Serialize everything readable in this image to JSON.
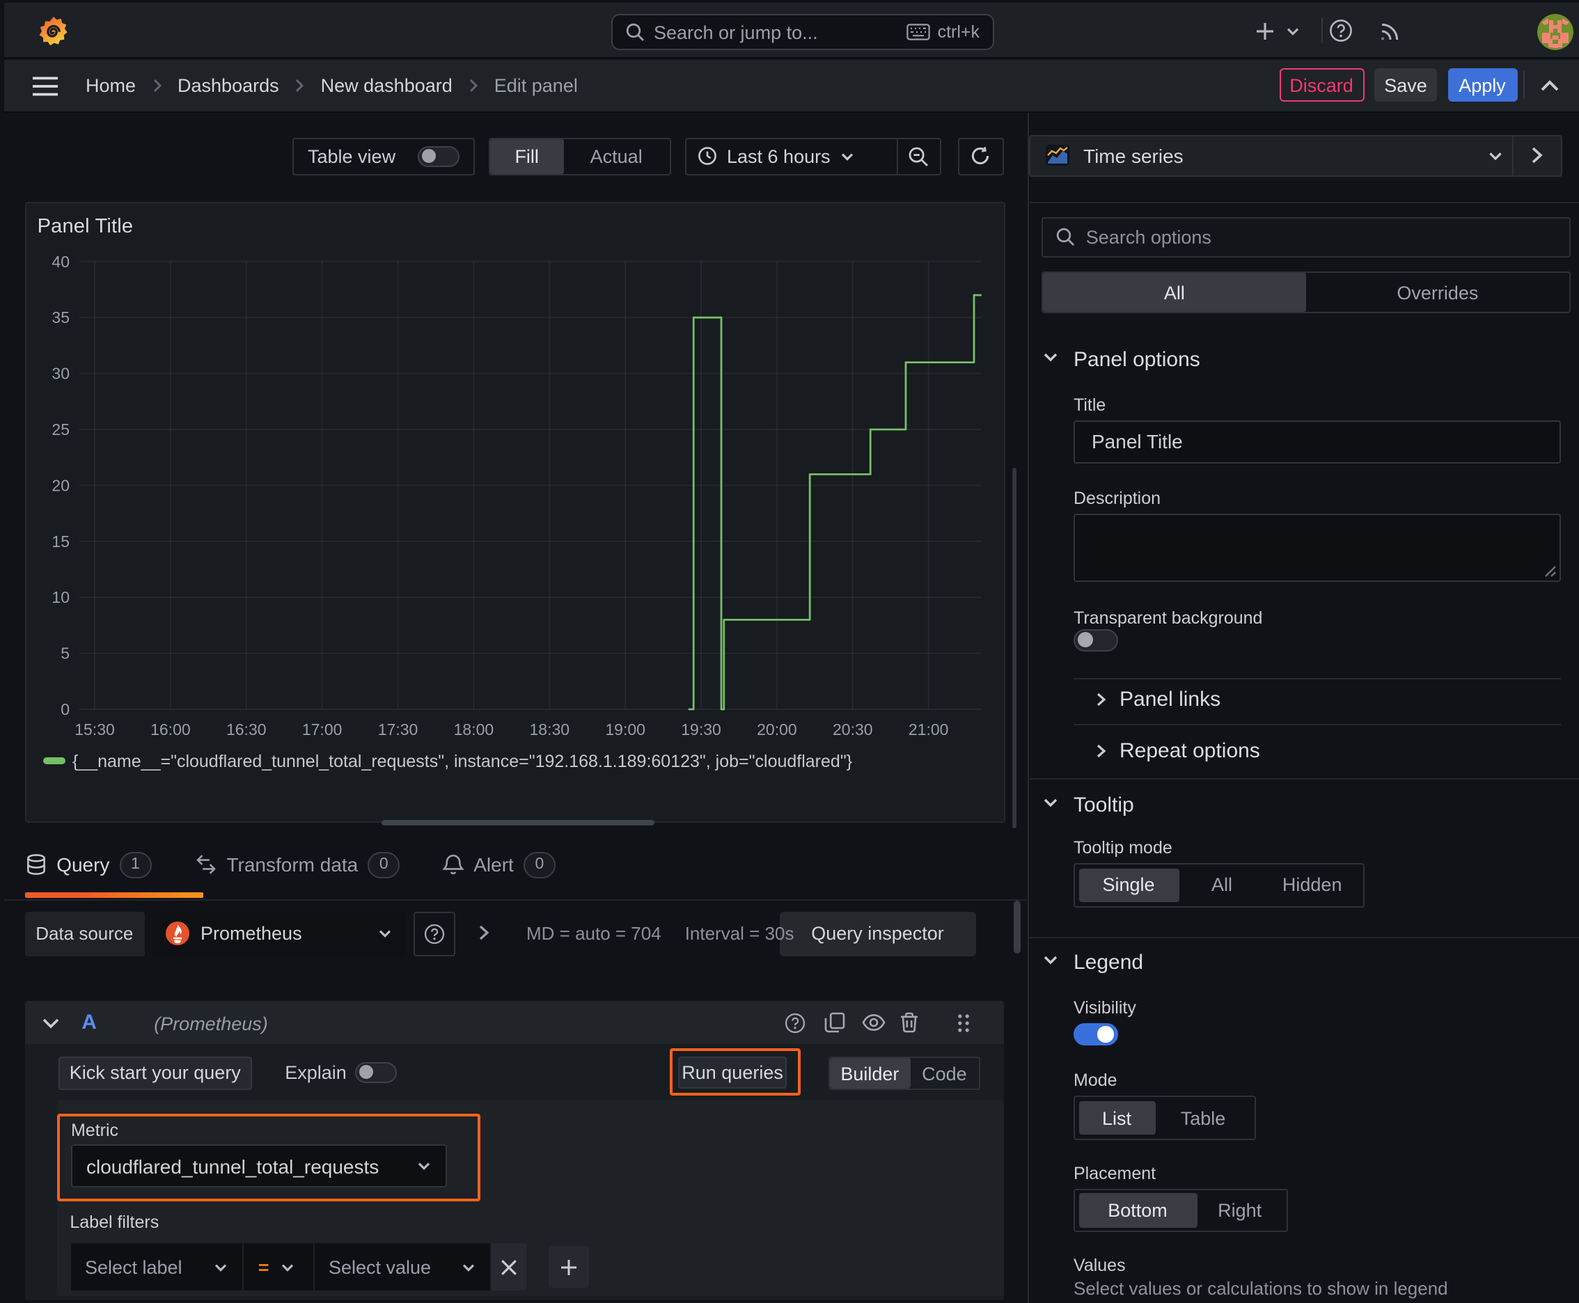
{
  "topbar": {
    "search_placeholder": "Search or jump to...",
    "shortcut": "ctrl+k"
  },
  "breadcrumb": {
    "items": [
      "Home",
      "Dashboards",
      "New dashboard",
      "Edit panel"
    ]
  },
  "actions": {
    "discard": "Discard",
    "save": "Save",
    "apply": "Apply"
  },
  "panel_toolbar": {
    "table_view": "Table view",
    "fill": "Fill",
    "actual": "Actual",
    "time_range": "Last 6 hours"
  },
  "panel": {
    "title": "Panel Title"
  },
  "chart_data": {
    "type": "line",
    "title": "Panel Title",
    "x_ticks": [
      "15:30",
      "16:00",
      "16:30",
      "17:00",
      "17:30",
      "18:00",
      "18:30",
      "19:00",
      "19:30",
      "20:00",
      "20:30",
      "21:00"
    ],
    "y_ticks": [
      0,
      5,
      10,
      15,
      20,
      25,
      30,
      35,
      40
    ],
    "ylim": [
      0,
      40
    ],
    "x_range": [
      "15:24",
      "21:21"
    ],
    "grid": true,
    "legend_position": "bottom",
    "series": [
      {
        "name": "{__name__=\"cloudflared_tunnel_total_requests\", instance=\"192.168.1.189:60123\", job=\"cloudflared\"}",
        "color": "#73bf69",
        "mode": "step-after",
        "points": [
          [
            "19:25",
            0
          ],
          [
            "19:27",
            35
          ],
          [
            "19:38",
            0
          ],
          [
            "19:39",
            8
          ],
          [
            "20:13",
            21
          ],
          [
            "20:37",
            25
          ],
          [
            "20:51",
            31
          ],
          [
            "21:18",
            37
          ]
        ],
        "end": "21:21"
      }
    ]
  },
  "tabs": {
    "query": "Query",
    "query_count": "1",
    "transform": "Transform data",
    "transform_count": "0",
    "alert": "Alert",
    "alert_count": "0"
  },
  "query_toolbar": {
    "data_source_label": "Data source",
    "data_source": "Prometheus",
    "stat_md": "MD = auto = 704",
    "stat_interval": "Interval = 30s",
    "inspector": "Query inspector"
  },
  "query_row": {
    "ref_id": "A",
    "datasource_hint": "(Prometheus)"
  },
  "query_editor": {
    "kick_start": "Kick start your query",
    "explain": "Explain",
    "run_queries": "Run queries",
    "builder": "Builder",
    "code": "Code",
    "metric_label": "Metric",
    "metric_value": "cloudflared_tunnel_total_requests",
    "label_filters": "Label filters",
    "select_label": "Select label",
    "operator": "=",
    "select_value": "Select value"
  },
  "options_pane": {
    "visualization": "Time series",
    "search_placeholder": "Search options",
    "tab_all": "All",
    "tab_overrides": "Overrides",
    "panel_options": {
      "title": "Panel options",
      "title_label": "Title",
      "title_value": "Panel Title",
      "description_label": "Description",
      "transparent_label": "Transparent background",
      "panel_links": "Panel links",
      "repeat_options": "Repeat options"
    },
    "tooltip": {
      "title": "Tooltip",
      "mode_label": "Tooltip mode",
      "modes": [
        "Single",
        "All",
        "Hidden"
      ],
      "selected": "Single"
    },
    "legend": {
      "title": "Legend",
      "visibility_label": "Visibility",
      "mode_label": "Mode",
      "modes": [
        "List",
        "Table"
      ],
      "selected_mode": "List",
      "placement_label": "Placement",
      "placements": [
        "Bottom",
        "Right"
      ],
      "selected_placement": "Bottom",
      "values_label": "Values",
      "values_placeholder": "Select values or calculations to show in legend"
    },
    "switches": {
      "table_view": false,
      "explain": false,
      "transparent": false,
      "visibility": true
    }
  },
  "colors": {
    "annotation_orange": "#f4621d",
    "series_green": "#73bf69",
    "primary_blue": "#3d71d9",
    "destructive_pink": "#f23a72"
  }
}
